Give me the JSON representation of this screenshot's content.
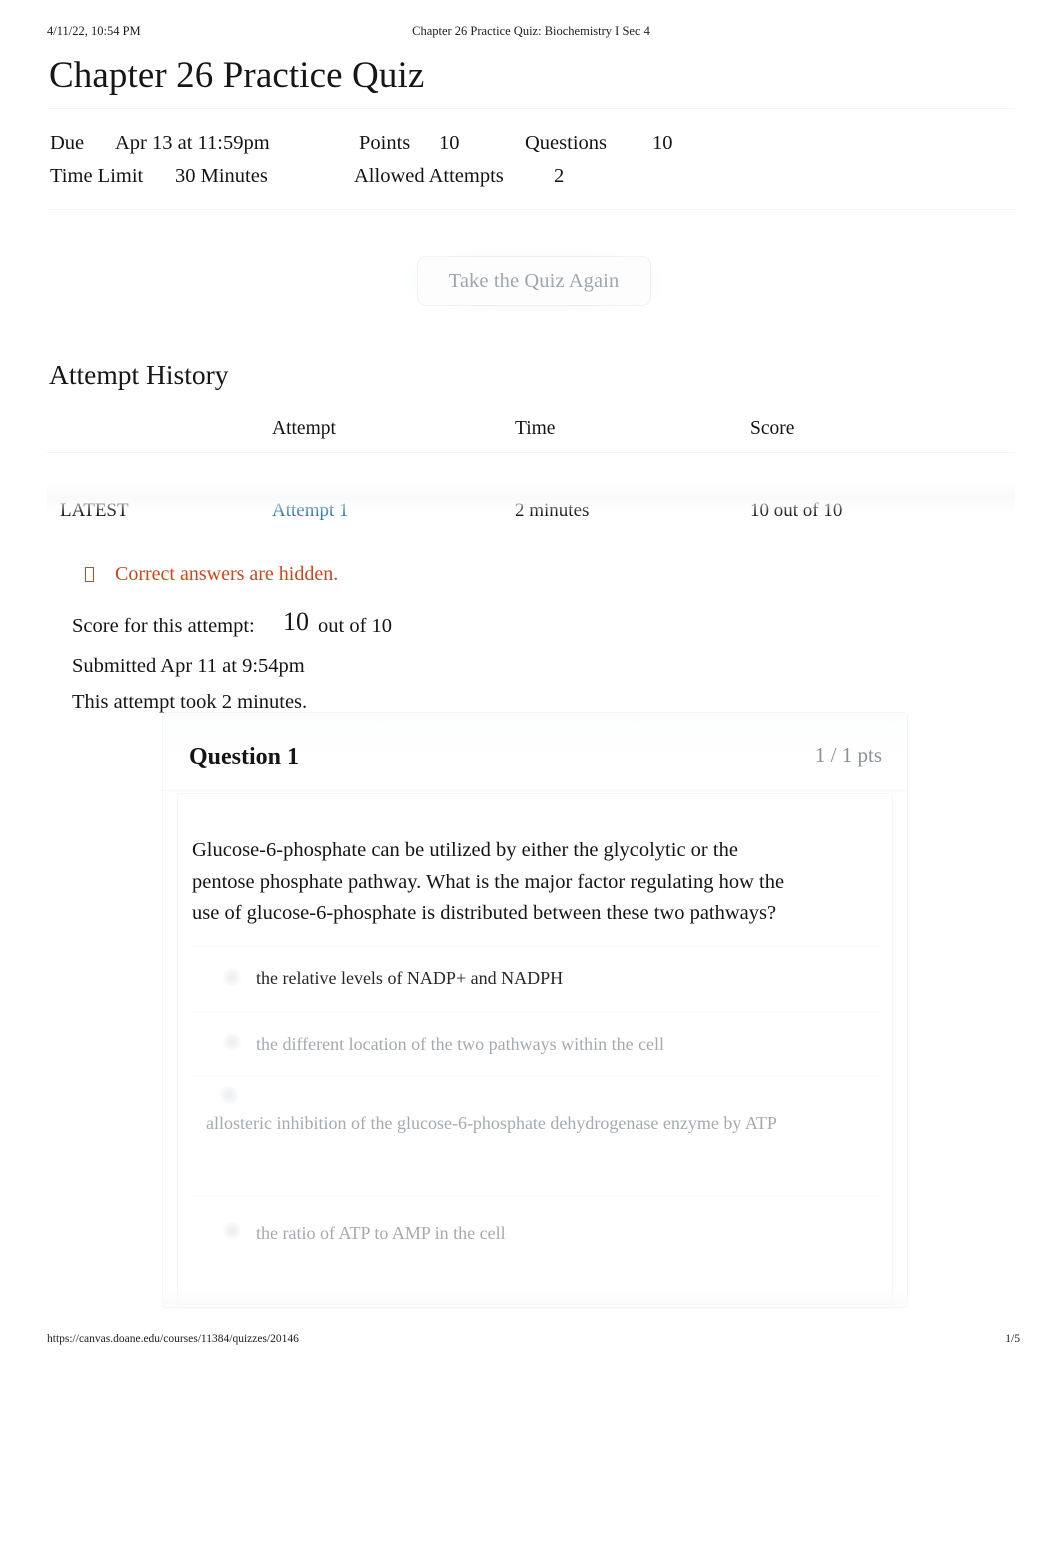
{
  "print_header": {
    "timestamp": "4/11/22, 10:54 PM",
    "document_title": "Chapter 26 Practice Quiz: Biochemistry I Sec 4"
  },
  "print_footer": {
    "url": "https://canvas.doane.edu/courses/11384/quizzes/20146",
    "page": "1/5"
  },
  "page": {
    "title": "Chapter 26 Practice Quiz"
  },
  "quiz_meta": {
    "due_label": "Due",
    "due_value": "Apr 13 at 11:59pm",
    "points_label": "Points",
    "points_value": "10",
    "questions_label": "Questions",
    "questions_value": "10",
    "time_limit_label": "Time Limit",
    "time_limit_value": "30 Minutes",
    "allowed_attempts_label": "Allowed Attempts",
    "allowed_attempts_value": "2"
  },
  "retake": {
    "label": "Take the Quiz Again"
  },
  "attempt_history": {
    "heading": "Attempt History",
    "columns": [
      "",
      "Attempt",
      "Time",
      "Score"
    ],
    "rows": [
      {
        "status": "LATEST",
        "attempt": "Attempt 1",
        "time": "2 minutes",
        "score": "10 out of 10"
      }
    ]
  },
  "notice": {
    "text": "Correct answers are hidden.",
    "icon": "warning-icon",
    "color": "#cf4619"
  },
  "attempt_summary": {
    "score_label": "Score for this attempt:",
    "score_value": "10",
    "score_outof": "out of 10",
    "submitted": "Submitted Apr 11 at 9:54pm",
    "duration": "This attempt took 2 minutes."
  },
  "question": {
    "title": "Question 1",
    "points": "1 / 1 pts",
    "text": "Glucose-6-phosphate can be utilized by either the glycolytic or the pentose phosphate pathway. What is the major factor regulating how the use of glucose-6-phosphate is distributed between these two pathways?",
    "answers": [
      "the relative levels of NADP+ and NADPH",
      "the different location of the two pathways within the cell",
      "allosteric inhibition of the glucose-6-phosphate dehydrogenase enzyme by ATP",
      "the ratio of ATP to AMP in the cell"
    ]
  },
  "colors": {
    "link": "#2d7ca3",
    "notice": "#cf4619",
    "muted_text": "#a4abb0",
    "body_text": "#141414"
  }
}
